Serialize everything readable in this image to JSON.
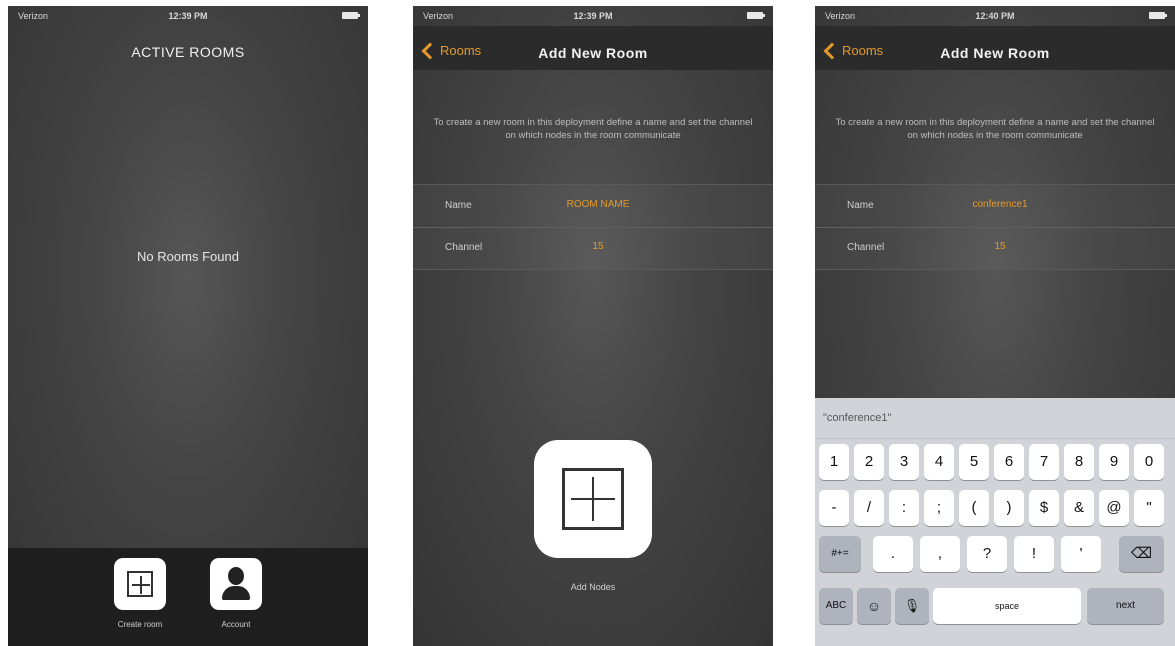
{
  "status": {
    "carrier": "Verizon",
    "battery_icon": "battery-icon"
  },
  "screen1": {
    "time": "12:39 PM",
    "title": "ACTIVE ROOMS",
    "empty_message": "No Rooms Found",
    "tabs": [
      {
        "label": "Create room",
        "icon": "plus-square-icon"
      },
      {
        "label": "Account",
        "icon": "person-icon"
      }
    ]
  },
  "screen2": {
    "time": "12:39 PM",
    "back_label": "Rooms",
    "title": "Add New Room",
    "intro": "To create a new room in this deployment define a name and set the channel on which nodes in the room communicate",
    "fields": {
      "name_label": "Name",
      "name_placeholder": "ROOM NAME",
      "channel_label": "Channel",
      "channel_value": "15"
    },
    "add_nodes_label": "Add Nodes"
  },
  "screen3": {
    "time": "12:40 PM",
    "back_label": "Rooms",
    "title": "Add New Room",
    "intro": "To create a new room in this deployment define a name and set the channel on which nodes in the room communicate",
    "fields": {
      "name_label": "Name",
      "name_value": "conference1",
      "channel_label": "Channel",
      "channel_value": "15"
    },
    "keyboard": {
      "suggestion": "\"conference1\"",
      "row1": [
        "1",
        "2",
        "3",
        "4",
        "5",
        "6",
        "7",
        "8",
        "9",
        "0"
      ],
      "row2": [
        "-",
        "/",
        ":",
        ";",
        "(",
        ")",
        "$",
        "&",
        "@",
        "\""
      ],
      "row3_left": "#+=",
      "row3": [
        ".",
        ",",
        "?",
        "!",
        "'"
      ],
      "backspace_icon": "backspace-icon",
      "abc": "ABC",
      "emoji_icon": "emoji-icon",
      "mic_icon": "mic-icon",
      "space": "space",
      "next": "next"
    }
  },
  "colors": {
    "accent": "#e39a2b",
    "navbar": "#2b2b2b",
    "tabbar": "#1f1f1f",
    "keyboard": "#d1d3d8"
  }
}
